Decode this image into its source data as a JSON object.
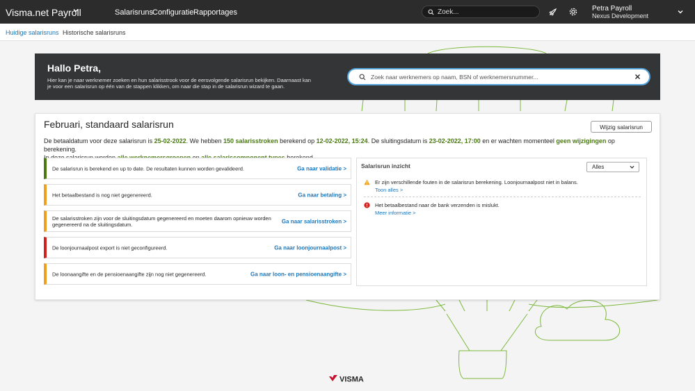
{
  "app": {
    "brand": "Visma.net  Payroll"
  },
  "nav": {
    "items": [
      "Salarisruns",
      "Configuratie",
      "Rapportages"
    ]
  },
  "topbar": {
    "search_placeholder": "Zoek...",
    "user_name": "Petra Payroll",
    "company": "Nexus Development"
  },
  "tabs": [
    "Huidige salarisruns",
    "Historische salarisruns"
  ],
  "hero": {
    "greeting": "Hallo Petra,",
    "intro": "Hier kan je naar werknemer zoeken en hun salarisstrook voor de eersvolgende salarisrun bekijken. Daarnaast kan je voor een salarisrun op één van de stappen klikken, om naar die stap in de salarisrun wizard te gaan.",
    "search_placeholder": "Zoek naar werknemers op naam, BSN of werknemersnummer..."
  },
  "run": {
    "title": "Februari, standaard salarisrun",
    "edit_button": "Wijzig salarisrun",
    "summary": {
      "t1": "De betaaldatum voor deze salarisrun is ",
      "b1": "25-02-2022",
      "t2": ". We hebben ",
      "b2": "150 salarisstroken",
      "t3": " berekend op ",
      "b3": "12-02-2022, 15:24",
      "t4": ". De sluitingsdatum is ",
      "b4": "23-02-2022, 17:00",
      "t5": " en er wachten momenteel ",
      "b5": "geen wijzigingen",
      "t6": " op berekening.",
      "t7": "In deze salarisrun worden ",
      "b6": "alle werknemersgroepen",
      "t8": " en ",
      "b7": "alle salariscomponent types",
      "t9": " berekend."
    },
    "steps": [
      {
        "message": "De salarisrun is berekend en up to date. De resultaten kunnen worden gevalideerd.",
        "link": "Ga naar validatie >",
        "status_color": "#4a7a12"
      },
      {
        "message": "Het betaalbestand is nog niet gegenereerd.",
        "link": "Ga naar betaling >",
        "status_color": "#f0a020"
      },
      {
        "message": "De salarisstroken zijn voor de sluitingsdatum gegenereerd en moeten daarom opnieuw worden gegenereerd na de sluitingsdatum.",
        "link": "Ga naar salarisstroken >",
        "status_color": "#f0a020"
      },
      {
        "message": "De loonjournaalpost export is niet geconfigureerd.",
        "link": "Ga naar loonjournaalpost >",
        "status_color": "#d0231f"
      },
      {
        "message": "De loonaangifte en de pensioenaangifte zijn nog niet gegenereerd.",
        "link": "Ga naar loon- en pensioenaangifte >",
        "status_color": "#f0a020"
      }
    ]
  },
  "insight": {
    "title": "Salarisrun inzicht",
    "filter": "Alles",
    "items": [
      {
        "icon": "warning-icon",
        "text": "Er zijn verschillende fouten in de salarisrun berekening. Loonjournaalpost niet in balans.",
        "link": "Toon alles >"
      },
      {
        "icon": "error-icon",
        "text": "Het betaalbestand naar de bank verzenden is mislukt.",
        "link": "Meer informatie >"
      }
    ]
  },
  "footer": {
    "logo": "VISMA"
  },
  "colors": {
    "accent": "#1b76bb",
    "positive": "#4a7a12",
    "warning": "#f0a020",
    "error": "#d0231f",
    "topbar": "#2c2c2c"
  }
}
